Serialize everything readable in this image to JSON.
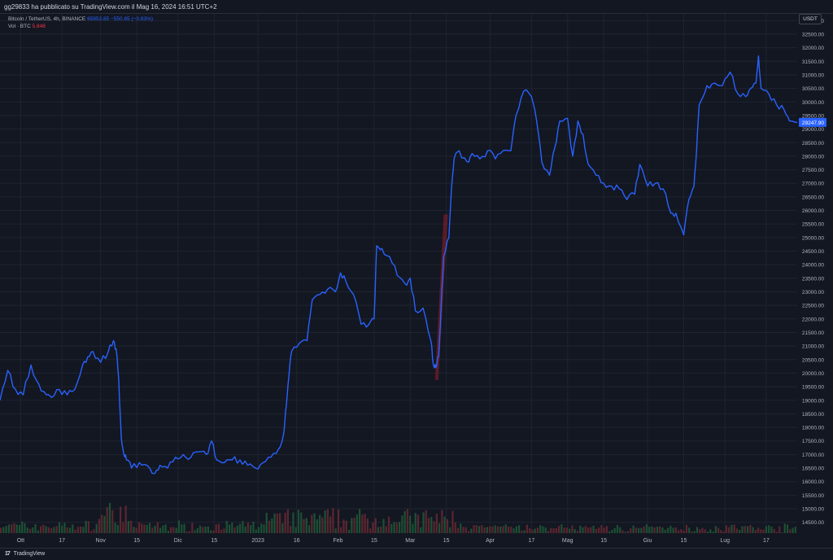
{
  "header": {
    "published_text": "gg29833 ha pubblicato su TradingView.com il Mag 16, 2024 16:51 UTC+2"
  },
  "legend": {
    "symbol": "Bitcoin / TetherUS, 4h, BINANCE",
    "price": "65953.85",
    "change": "−550.85 (−0.83%)",
    "volume_label": "Vol · BTC",
    "volume_value": "5.848"
  },
  "price_scale": {
    "currency": "USDT"
  },
  "footer": {
    "brand": "TradingView"
  },
  "colors": {
    "background": "#131722",
    "line": "#2962ff",
    "grid": "#1f2430",
    "volume_up": "#1f5f3a",
    "volume_down": "#6e2a33",
    "highlight": "#8b1e2a"
  },
  "chart_data": {
    "type": "line",
    "ylim": [
      14100,
      33250
    ],
    "yticks": [
      14500,
      15000,
      15500,
      16000,
      16500,
      17000,
      17500,
      18000,
      18500,
      19000,
      19500,
      20000,
      20500,
      21000,
      21500,
      22000,
      22500,
      23000,
      23500,
      24000,
      24500,
      25000,
      25500,
      26000,
      26500,
      27000,
      27500,
      28000,
      28500,
      29000,
      29500,
      30000,
      30500,
      31000,
      31500,
      32000,
      32500,
      33000
    ],
    "ytick_labels": [
      "14500.00",
      "15000.00",
      "15500.00",
      "16000.00",
      "16500.00",
      "17000.00",
      "17500.00",
      "18000.00",
      "18500.00",
      "19000.00",
      "19500.00",
      "20000.00",
      "20500.00",
      "21000.00",
      "21500.00",
      "22000.00",
      "22500.00",
      "23000.00",
      "23500.00",
      "24000.00",
      "24500.00",
      "25000.00",
      "25500.00",
      "26000.00",
      "26500.00",
      "27000.00",
      "27500.00",
      "28000.00",
      "28500.00",
      "29000.00",
      "29500.00",
      "30000.00",
      "30500.00",
      "31000.00",
      "31500.00",
      "32000.00",
      "32500.00",
      "33000.00"
    ],
    "x_range": [
      "2022-09-23",
      "2023-07-29"
    ],
    "xticks": [
      {
        "date": "2022-10-01",
        "label": "Ott"
      },
      {
        "date": "2022-10-17",
        "label": "17"
      },
      {
        "date": "2022-11-01",
        "label": "Nov"
      },
      {
        "date": "2022-11-15",
        "label": "15"
      },
      {
        "date": "2022-12-01",
        "label": "Dic"
      },
      {
        "date": "2022-12-15",
        "label": "15"
      },
      {
        "date": "2023-01-01",
        "label": "2023"
      },
      {
        "date": "2023-01-16",
        "label": "16"
      },
      {
        "date": "2023-02-01",
        "label": "Feb"
      },
      {
        "date": "2023-02-15",
        "label": "15"
      },
      {
        "date": "2023-03-01",
        "label": "Mar"
      },
      {
        "date": "2023-03-15",
        "label": "15"
      },
      {
        "date": "2023-04-01",
        "label": "Apr"
      },
      {
        "date": "2023-04-17",
        "label": "17"
      },
      {
        "date": "2023-05-01",
        "label": "Mag"
      },
      {
        "date": "2023-05-15",
        "label": "15"
      },
      {
        "date": "2023-06-01",
        "label": "Giu"
      },
      {
        "date": "2023-06-15",
        "label": "15"
      },
      {
        "date": "2023-07-01",
        "label": "Lug"
      },
      {
        "date": "2023-07-17",
        "label": "17"
      }
    ],
    "last_value_label": "29247.90",
    "last_value": 29247.9,
    "highlight": {
      "x_start": "2023-03-10",
      "x_end": "2023-03-14",
      "y_low": 19750,
      "y_high": 25850
    },
    "series": [
      {
        "x": [
          "2022-09-23",
          "2022-09-26",
          "2022-09-29",
          "2022-10-02",
          "2022-10-05",
          "2022-10-08",
          "2022-10-11",
          "2022-10-13",
          "2022-10-16",
          "2022-10-19",
          "2022-10-22",
          "2022-10-25",
          "2022-10-27",
          "2022-10-29",
          "2022-11-01",
          "2022-11-04",
          "2022-11-06",
          "2022-11-07",
          "2022-11-08",
          "2022-11-09",
          "2022-11-10",
          "2022-11-11",
          "2022-11-13",
          "2022-11-16",
          "2022-11-19",
          "2022-11-22",
          "2022-11-24",
          "2022-11-27",
          "2022-11-30",
          "2022-12-03",
          "2022-12-06",
          "2022-12-09",
          "2022-12-12",
          "2022-12-14",
          "2022-12-16",
          "2022-12-19",
          "2022-12-22",
          "2022-12-25",
          "2022-12-28",
          "2022-12-31",
          "2023-01-03",
          "2023-01-06",
          "2023-01-09",
          "2023-01-11",
          "2023-01-12",
          "2023-01-13",
          "2023-01-14",
          "2023-01-17",
          "2023-01-20",
          "2023-01-22",
          "2023-01-25",
          "2023-01-28",
          "2023-01-31",
          "2023-02-02",
          "2023-02-04",
          "2023-02-07",
          "2023-02-10",
          "2023-02-13",
          "2023-02-15",
          "2023-02-16",
          "2023-02-18",
          "2023-02-21",
          "2023-02-24",
          "2023-02-27",
          "2023-03-01",
          "2023-03-03",
          "2023-03-06",
          "2023-03-09",
          "2023-03-10",
          "2023-03-11",
          "2023-03-12",
          "2023-03-13",
          "2023-03-14",
          "2023-03-16",
          "2023-03-17",
          "2023-03-18",
          "2023-03-20",
          "2023-03-23",
          "2023-03-25",
          "2023-03-28",
          "2023-03-31",
          "2023-04-03",
          "2023-04-06",
          "2023-04-09",
          "2023-04-11",
          "2023-04-14",
          "2023-04-17",
          "2023-04-19",
          "2023-04-21",
          "2023-04-24",
          "2023-04-26",
          "2023-04-28",
          "2023-05-01",
          "2023-05-03",
          "2023-05-05",
          "2023-05-07",
          "2023-05-09",
          "2023-05-12",
          "2023-05-15",
          "2023-05-18",
          "2023-05-21",
          "2023-05-24",
          "2023-05-27",
          "2023-05-29",
          "2023-06-01",
          "2023-06-04",
          "2023-06-07",
          "2023-06-10",
          "2023-06-12",
          "2023-06-15",
          "2023-06-17",
          "2023-06-19",
          "2023-06-20",
          "2023-06-21",
          "2023-06-22",
          "2023-06-24",
          "2023-06-27",
          "2023-06-30",
          "2023-07-03",
          "2023-07-06",
          "2023-07-09",
          "2023-07-11",
          "2023-07-13",
          "2023-07-14",
          "2023-07-15",
          "2023-07-18",
          "2023-07-21",
          "2023-07-24",
          "2023-07-26",
          "2023-07-29"
        ],
        "values": [
          19000,
          20100,
          19400,
          19200,
          20300,
          19600,
          19200,
          19100,
          19400,
          19200,
          19400,
          20300,
          20600,
          20800,
          20400,
          20800,
          21200,
          20900,
          19800,
          17600,
          17000,
          16800,
          16500,
          16700,
          16600,
          16300,
          16600,
          16500,
          16900,
          17000,
          16900,
          17100,
          17000,
          17500,
          16800,
          16700,
          16800,
          16800,
          16600,
          16500,
          16700,
          16900,
          17200,
          17800,
          18800,
          19900,
          20800,
          21100,
          21200,
          22700,
          22900,
          23100,
          23000,
          23700,
          23400,
          22900,
          21800,
          21800,
          22000,
          24700,
          24600,
          24300,
          23600,
          23300,
          23500,
          22300,
          22400,
          21200,
          20300,
          20200,
          20600,
          22500,
          24300,
          25000,
          26800,
          27900,
          28200,
          27800,
          28100,
          27900,
          28200,
          27900,
          28200,
          28200,
          29500,
          30400,
          30200,
          29300,
          27800,
          27300,
          28300,
          29300,
          29400,
          28000,
          29300,
          28800,
          27700,
          27300,
          27000,
          26900,
          26800,
          26400,
          26600,
          27700,
          26900,
          27000,
          26800,
          25900,
          25900,
          25100,
          26400,
          26900,
          28200,
          29900,
          30100,
          30600,
          30700,
          30600,
          31100,
          30300,
          30200,
          30500,
          30700,
          31700,
          30500,
          30300,
          29900,
          29700,
          29300,
          29250
        ]
      }
    ]
  }
}
